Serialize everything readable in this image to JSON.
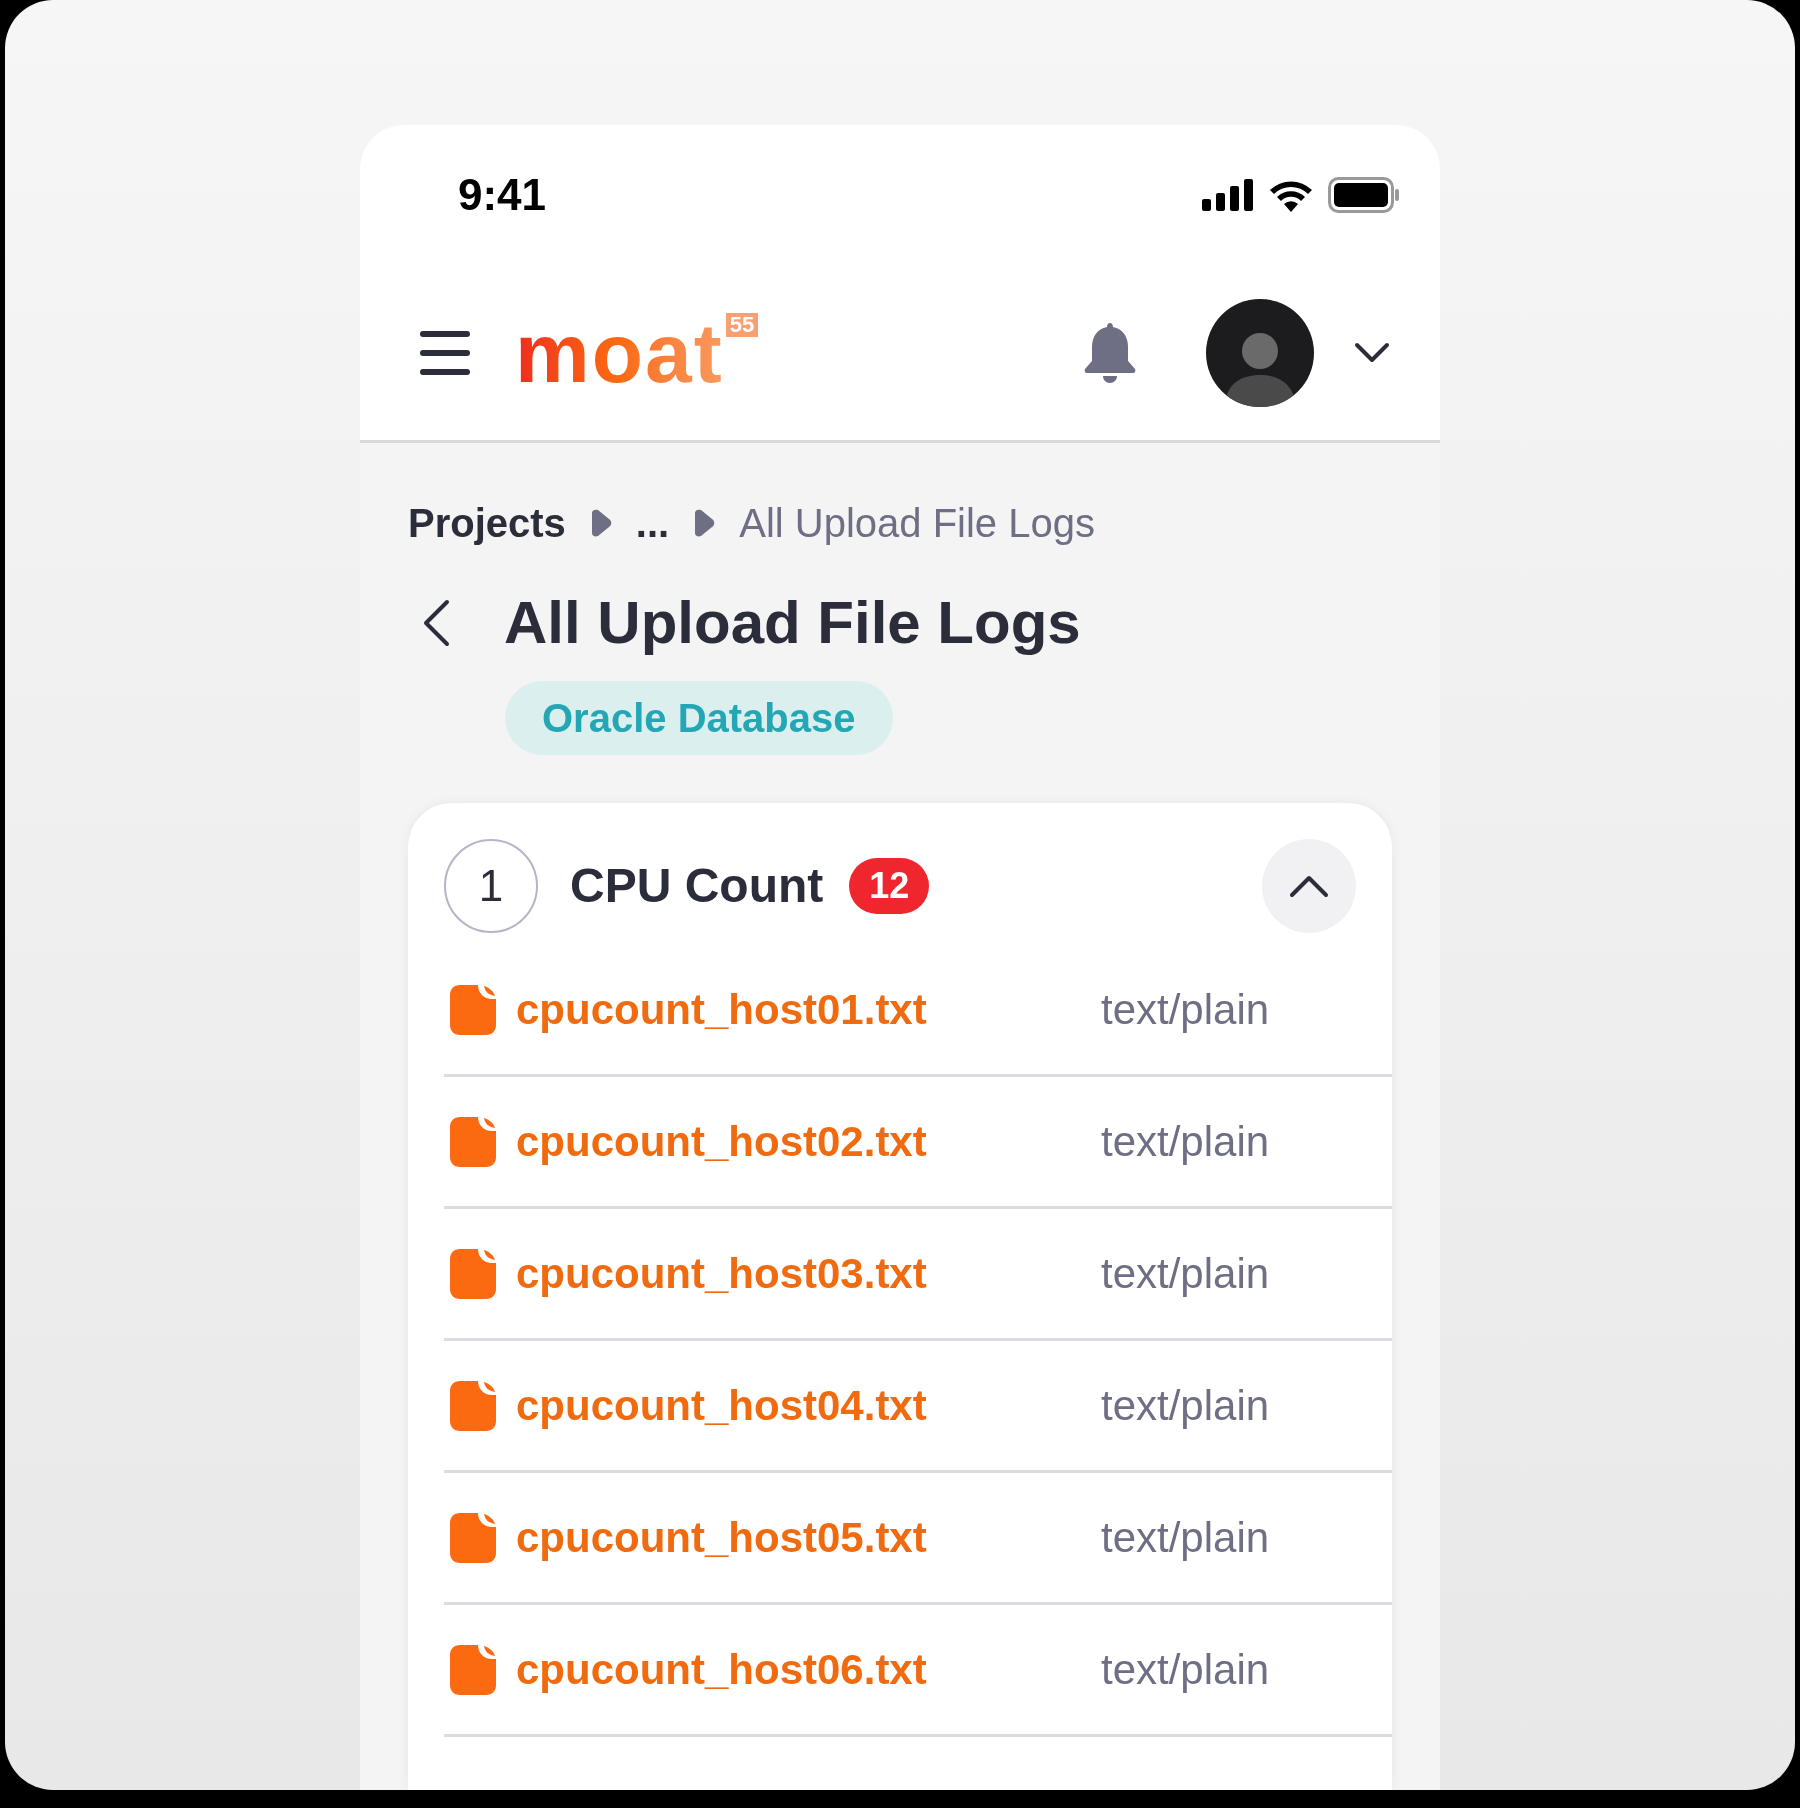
{
  "status_bar": {
    "time": "9:41"
  },
  "header": {
    "logo": "moat",
    "logo_badge": "55"
  },
  "breadcrumb": [
    {
      "label": "Projects",
      "current": false
    },
    {
      "label": "...",
      "current": false
    },
    {
      "label": "All Upload File Logs",
      "current": true
    }
  ],
  "page_title": "All Upload File Logs",
  "tag": "Oracle Database",
  "section": {
    "number": "1",
    "title": "CPU Count",
    "count": "12",
    "expanded": true,
    "files": [
      {
        "name": "cpucount_host01.txt",
        "type": "text/plain"
      },
      {
        "name": "cpucount_host02.txt",
        "type": "text/plain"
      },
      {
        "name": "cpucount_host03.txt",
        "type": "text/plain"
      },
      {
        "name": "cpucount_host04.txt",
        "type": "text/plain"
      },
      {
        "name": "cpucount_host05.txt",
        "type": "text/plain"
      },
      {
        "name": "cpucount_host06.txt",
        "type": "text/plain"
      }
    ]
  }
}
